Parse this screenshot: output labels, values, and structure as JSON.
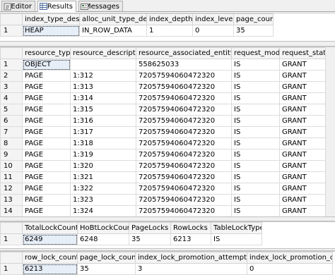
{
  "tabs": [
    {
      "label": "Editor",
      "icon": "editor-icon"
    },
    {
      "label": "Results",
      "icon": "grid-icon",
      "active": true
    },
    {
      "label": "Messages",
      "icon": "messages-icon"
    }
  ],
  "grid1": {
    "columns": [
      "index_type_desc",
      "alloc_unit_type_desc",
      "index_depth",
      "index_level",
      "page_count"
    ],
    "rows": [
      {
        "rn": "1",
        "cells": [
          "HEAP",
          "IN_ROW_DATA",
          "1",
          "0",
          "35"
        ]
      }
    ]
  },
  "grid2": {
    "columns": [
      "resource_type",
      "resource_description",
      "resource_associated_entity_id",
      "request_mode",
      "request_status"
    ],
    "rows": [
      {
        "rn": "1",
        "cells": [
          "OBJECT",
          "",
          "558625033",
          "IS",
          "GRANT"
        ]
      },
      {
        "rn": "2",
        "cells": [
          "PAGE",
          "1:312",
          "72057594060472320",
          "IS",
          "GRANT"
        ]
      },
      {
        "rn": "3",
        "cells": [
          "PAGE",
          "1:313",
          "72057594060472320",
          "IS",
          "GRANT"
        ]
      },
      {
        "rn": "4",
        "cells": [
          "PAGE",
          "1:314",
          "72057594060472320",
          "IS",
          "GRANT"
        ]
      },
      {
        "rn": "5",
        "cells": [
          "PAGE",
          "1:315",
          "72057594060472320",
          "IS",
          "GRANT"
        ]
      },
      {
        "rn": "6",
        "cells": [
          "PAGE",
          "1:316",
          "72057594060472320",
          "IS",
          "GRANT"
        ]
      },
      {
        "rn": "7",
        "cells": [
          "PAGE",
          "1:317",
          "72057594060472320",
          "IS",
          "GRANT"
        ]
      },
      {
        "rn": "8",
        "cells": [
          "PAGE",
          "1:318",
          "72057594060472320",
          "IS",
          "GRANT"
        ]
      },
      {
        "rn": "9",
        "cells": [
          "PAGE",
          "1:319",
          "72057594060472320",
          "IS",
          "GRANT"
        ]
      },
      {
        "rn": "10",
        "cells": [
          "PAGE",
          "1:320",
          "72057594060472320",
          "IS",
          "GRANT"
        ]
      },
      {
        "rn": "11",
        "cells": [
          "PAGE",
          "1:321",
          "72057594060472320",
          "IS",
          "GRANT"
        ]
      },
      {
        "rn": "12",
        "cells": [
          "PAGE",
          "1:322",
          "72057594060472320",
          "IS",
          "GRANT"
        ]
      },
      {
        "rn": "13",
        "cells": [
          "PAGE",
          "1:323",
          "72057594060472320",
          "IS",
          "GRANT"
        ]
      },
      {
        "rn": "14",
        "cells": [
          "PAGE",
          "1:324",
          "72057594060472320",
          "IS",
          "GRANT"
        ]
      },
      {
        "rn": "15",
        "cells": [
          "PAGE",
          "1:325",
          "72057594060472320",
          "IS",
          "GRANT"
        ]
      }
    ]
  },
  "grid3": {
    "columns": [
      "TotalLockCount",
      "HoBtLockCount",
      "PageLocks",
      "RowLocks",
      "TableLockType"
    ],
    "rows": [
      {
        "rn": "1",
        "cells": [
          "6249",
          "6248",
          "35",
          "6213",
          "IS"
        ]
      }
    ]
  },
  "grid4": {
    "columns": [
      "row_lock_count",
      "page_lock_count",
      "index_lock_promotion_attempt_count",
      "index_lock_promotion_count"
    ],
    "rows": [
      {
        "rn": "1",
        "cells": [
          "6213",
          "35",
          "3",
          "0"
        ]
      }
    ]
  },
  "colors": {
    "header_bg": "#f4f4f4",
    "selected_cell_bg": "#e6eef8",
    "grid_line": "#dcdcdc"
  }
}
